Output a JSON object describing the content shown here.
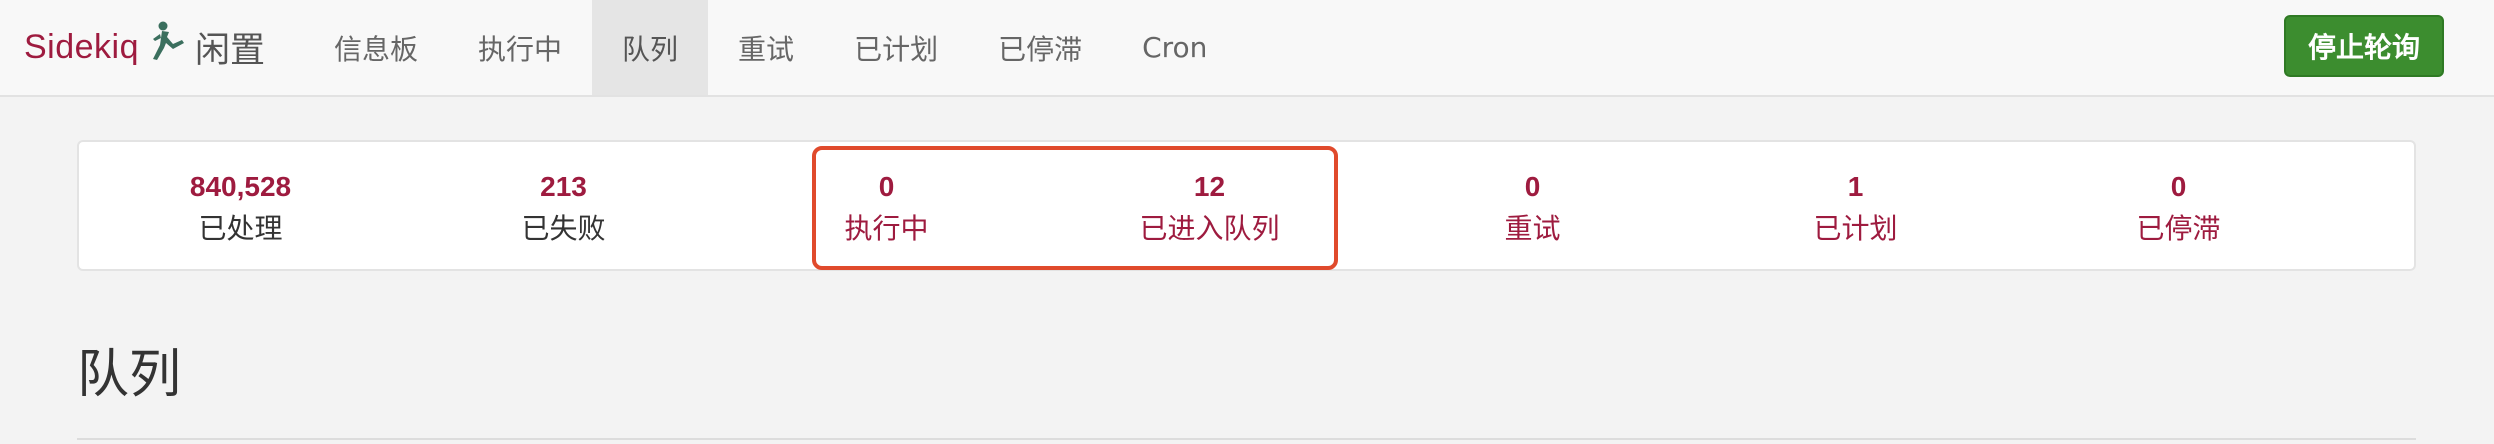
{
  "brand": {
    "name": "Sidekiq",
    "logo_icon": "sidekiq-kicker-icon",
    "status": "闲置",
    "color": "#9e1b3f"
  },
  "nav": {
    "items": [
      {
        "label": "信息板",
        "active": false
      },
      {
        "label": "执行中",
        "active": false
      },
      {
        "label": "队列",
        "active": true
      },
      {
        "label": "重试",
        "active": false
      },
      {
        "label": "已计划",
        "active": false
      },
      {
        "label": "已停滞",
        "active": false
      },
      {
        "label": "Cron",
        "active": false
      }
    ],
    "stop_polling_label": "停止轮询",
    "stop_polling_color": "#3c8d2f"
  },
  "summary": {
    "processed": {
      "count": "840,528",
      "label": "已处理"
    },
    "failed": {
      "count": "213",
      "label": "已失败"
    },
    "busy": {
      "count": "0",
      "label": "执行中"
    },
    "enqueued": {
      "count": "12",
      "label": "已进入队列"
    },
    "retries": {
      "count": "0",
      "label": "重试"
    },
    "scheduled": {
      "count": "1",
      "label": "已计划"
    },
    "dead": {
      "count": "0",
      "label": "已停滞"
    },
    "highlight_color": "#e04a2c"
  },
  "page": {
    "title": "队列"
  }
}
